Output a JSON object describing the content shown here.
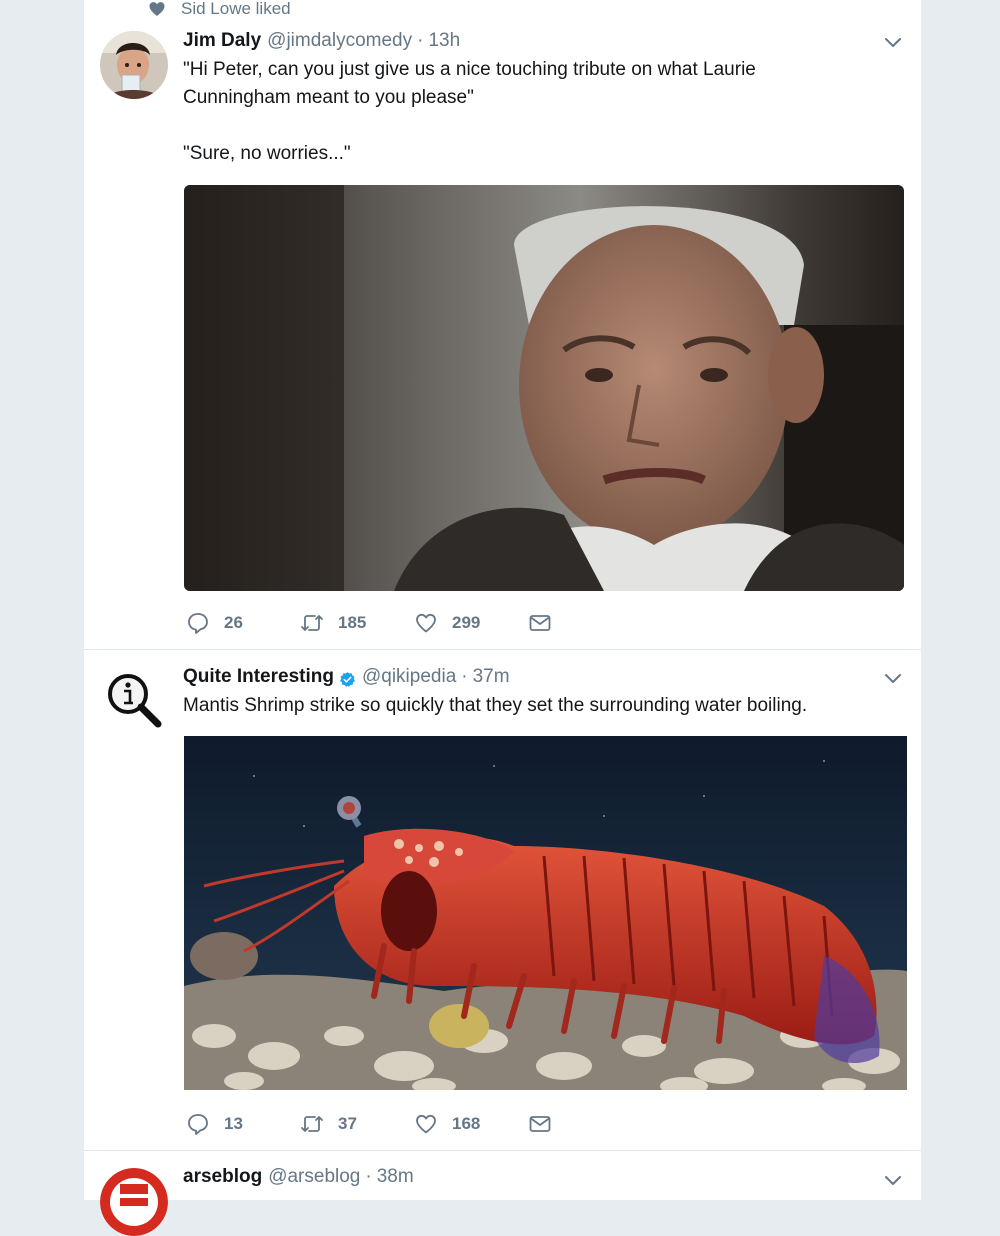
{
  "context": {
    "text": "Sid Lowe liked"
  },
  "tweets": [
    {
      "name": "Jim Daly",
      "handle": "@jimdalycomedy",
      "separator": "·",
      "time": "13h",
      "text_lines": [
        "\"Hi Peter, can you just give us a nice touching tribute on what Laurie",
        "Cunningham meant to you please\"",
        "\"Sure, no worries...\""
      ],
      "media_icon": "video-still-man-speaking",
      "replies": "26",
      "retweets": "185",
      "likes": "299"
    },
    {
      "name": "Quite Interesting",
      "handle": "@qikipedia",
      "separator": "·",
      "time": "37m",
      "verified": true,
      "text_lines": [
        "Mantis Shrimp strike so quickly that they set the surrounding water boiling."
      ],
      "media_icon": "photo-mantis-shrimp",
      "replies": "13",
      "retweets": "37",
      "likes": "168"
    },
    {
      "name": "arseblog",
      "handle": "@arseblog",
      "separator": "·",
      "time": "38m"
    }
  ],
  "colors": {
    "page_bg": "#e6ecf0",
    "card_bg": "#ffffff",
    "text": "#14171a",
    "muted": "#657786",
    "verified": "#1da1f2",
    "divider": "#e1e8ed"
  }
}
